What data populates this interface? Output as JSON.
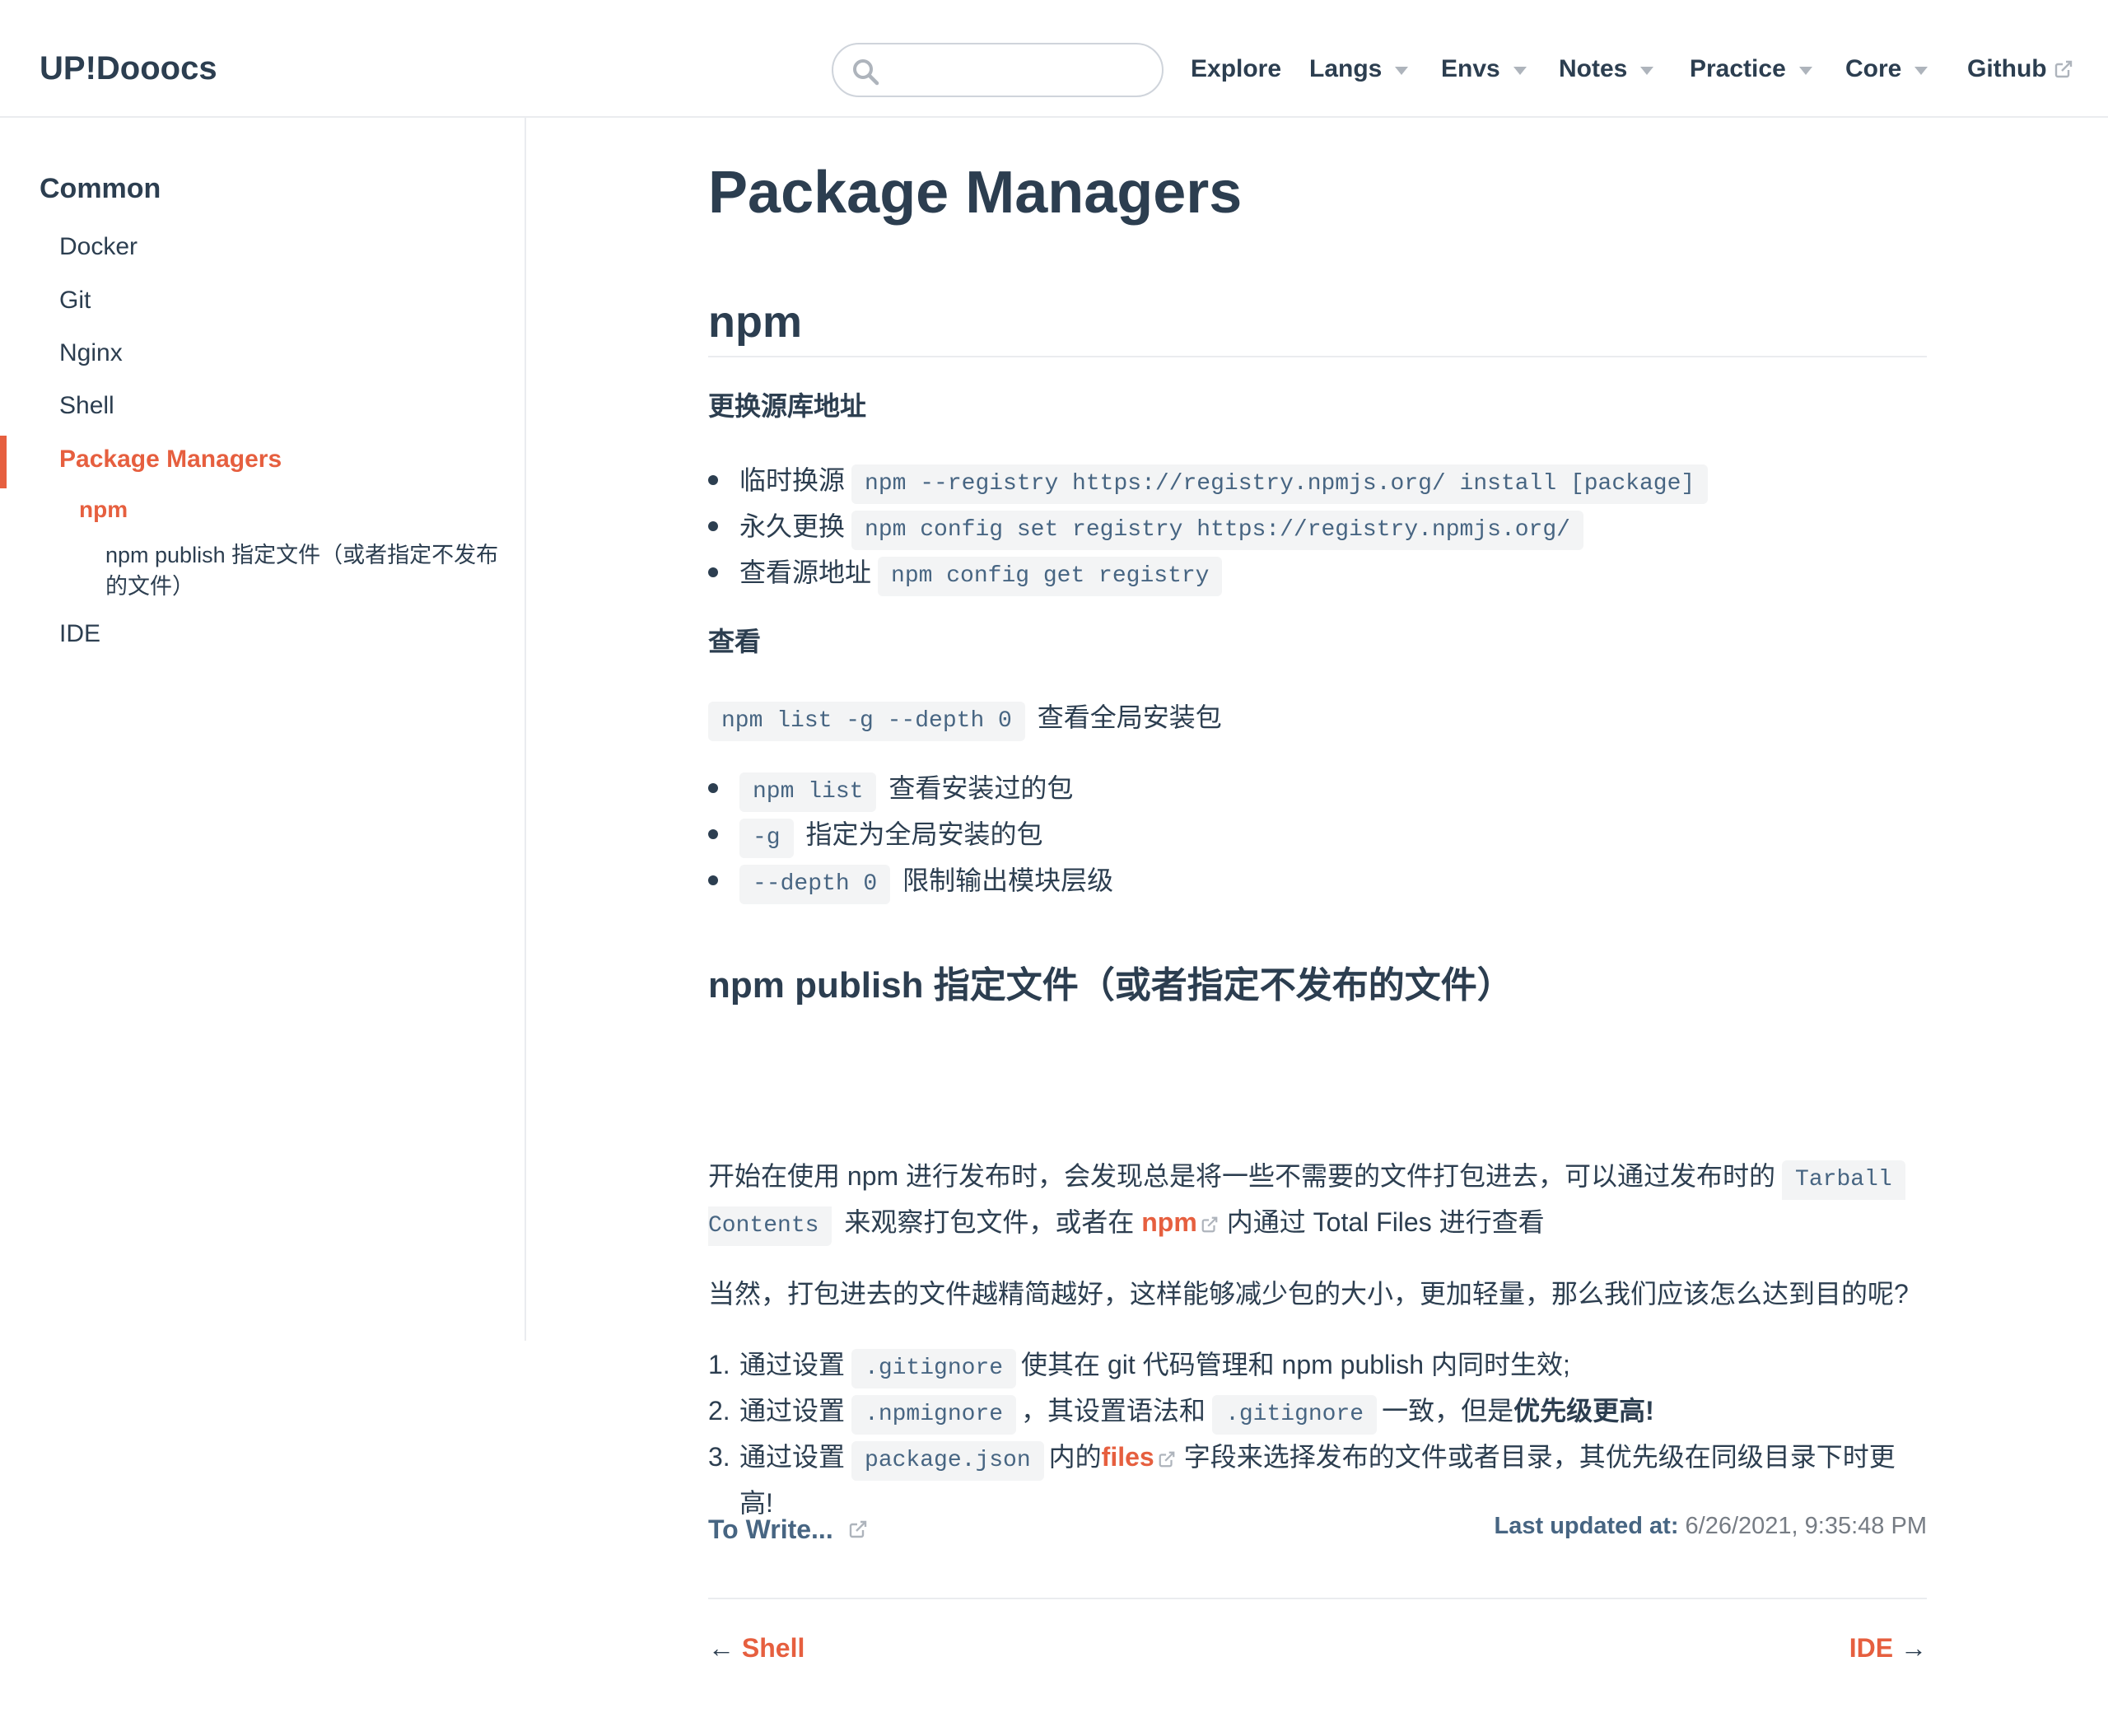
{
  "navbar": {
    "logo": "UP!Dooocs",
    "search": {
      "placeholder": "",
      "value": ""
    },
    "items": [
      {
        "label": "Explore",
        "dropdown": false
      },
      {
        "label": "Langs",
        "dropdown": true
      },
      {
        "label": "Envs",
        "dropdown": true
      },
      {
        "label": "Notes",
        "dropdown": true
      },
      {
        "label": "Practice",
        "dropdown": true
      },
      {
        "label": "Core",
        "dropdown": true
      },
      {
        "label": "Github",
        "external": true
      }
    ]
  },
  "sidebar": {
    "heading": "Common",
    "items": [
      "Docker",
      "Git",
      "Nginx",
      "Shell",
      "Package Managers",
      "IDE"
    ],
    "active_sub": "npm",
    "active_subsub": "npm publish 指定文件（或者指定不发布的文件）"
  },
  "content": {
    "title": "Package Managers",
    "npm_heading": "npm",
    "registry_heading": "更换源库地址",
    "registry_items": [
      {
        "text": "临时换源",
        "code": "npm --registry https://registry.npmjs.org/ install [package]"
      },
      {
        "text": "永久更换",
        "code": "npm config set registry https://registry.npmjs.org/"
      },
      {
        "text": "查看源地址",
        "code": "npm config get registry"
      }
    ],
    "view_heading": "查看",
    "list_code": "npm list -g --depth 0",
    "list_desc": "查看全局安装包",
    "list_items": [
      {
        "code": "npm list",
        "text": "查看安装过的包"
      },
      {
        "code": "-g",
        "text": "指定为全局安装的包"
      },
      {
        "code": "--depth 0",
        "text": "限制输出模块层级"
      }
    ],
    "publish_heading": "npm publish 指定文件（或者指定不发布的文件）",
    "p1": {
      "a": "开始在使用 npm 进行发布时，会发现总是将一些不需要的文件打包进去，可以通过发布时的",
      "code_line1": "Tarball",
      "code_line2": "Contents",
      "b": "来观察打包文件，或者在",
      "link": "npm",
      "c": "内通过 Total Files 进行查看"
    },
    "p2": "当然，打包进去的文件越精简越好，这样能够减少包的大小，更加轻量，那么我们应该怎么达到目的呢?",
    "ol": {
      "i1": {
        "num": "1.",
        "a": "通过设置",
        "code": ".gitignore",
        "b": "使其在 git 代码管理和 npm publish 内同时生效;"
      },
      "i2": {
        "num": "2.",
        "a": "通过设置",
        "code": ".npmignore",
        "b": "，其设置语法和",
        "code2": ".gitignore",
        "c": "一致，但是",
        "strong": "优先级更高!"
      },
      "i3": {
        "num": "3.",
        "a": "通过设置",
        "code": "package.json",
        "b": "内的",
        "link": "files",
        "c": "字段来选择发布的文件或者目录，其优先级在同级目录下时更",
        "d": "高!"
      }
    }
  },
  "footer": {
    "edit_label": "To Write...",
    "last_updated_label": "Last updated at:",
    "last_updated_value": "6/26/2021, 9:35:48 PM",
    "prev_arrow": "←",
    "prev_label": "Shell",
    "next_label": "IDE",
    "next_arrow": "→"
  },
  "colors": {
    "accent": "#e65f3f",
    "text": "#2c3e50",
    "code_text": "#476582",
    "code_bg": "#f3f4f5",
    "border": "#eaecef"
  }
}
